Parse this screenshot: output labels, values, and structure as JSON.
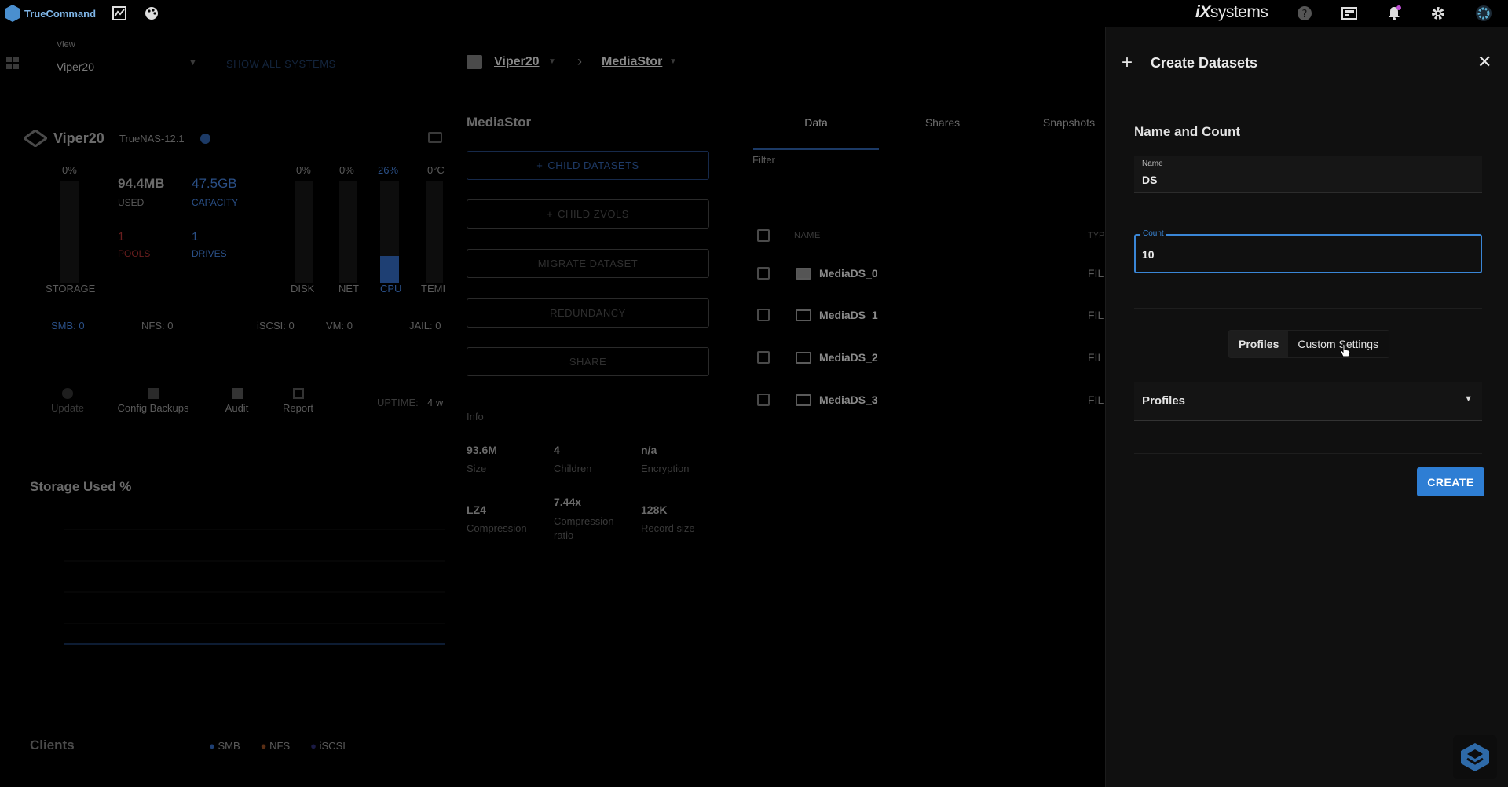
{
  "app": {
    "name": "TrueCommand"
  },
  "topbar": {
    "brand_prefix": "iX",
    "brand_suffix": "systems"
  },
  "view": {
    "label": "View",
    "selected": "Viper20",
    "show_all": "SHOW ALL SYSTEMS"
  },
  "breadcrumb": {
    "system": "Viper20",
    "pool": "MediaStor"
  },
  "system": {
    "name": "Viper20",
    "version": "TrueNAS-12.1",
    "storage_pct": "0%",
    "used_value": "94.4MB",
    "used_label": "USED",
    "capacity_value": "47.5GB",
    "capacity_label": "CAPACITY",
    "pools_value": "1",
    "pools_label": "POOLS",
    "drives_value": "1",
    "drives_label": "DRIVES",
    "storage_label": "STORAGE",
    "disk_pct": "0%",
    "disk_label": "DISK",
    "net_pct": "0%",
    "net_label": "NET",
    "cpu_pct": "26%",
    "cpu_label": "CPU",
    "cpu_level": 0.26,
    "temp_value": "0°C",
    "temp_label": "TEMI",
    "smb": "SMB: 0",
    "nfs": "NFS: 0",
    "iscsi": "iSCSI: 0",
    "vm": "VM: 0",
    "jail": "JAIL: 0",
    "actions": [
      "Update",
      "Config Backups",
      "Audit",
      "Report"
    ],
    "uptime_label": "UPTIME:",
    "uptime_value": "4 w"
  },
  "storage_chart": {
    "title": "Storage Used %"
  },
  "clients": {
    "title": "Clients",
    "legend": [
      "SMB",
      "NFS",
      "iSCSI"
    ]
  },
  "dataset": {
    "title": "MediaStor",
    "buttons": [
      "CHILD DATASETS",
      "CHILD ZVOLS",
      "MIGRATE DATASET",
      "REDUNDANCY",
      "SHARE"
    ],
    "info_label": "Info",
    "info": [
      {
        "value": "93.6M",
        "label": "Size"
      },
      {
        "value": "4",
        "label": "Children"
      },
      {
        "value": "n/a",
        "label": "Encryption"
      },
      {
        "value": "LZ4",
        "label": "Compression"
      },
      {
        "value": "7.44x",
        "label": "Compression ratio"
      },
      {
        "value": "128K",
        "label": "Record size"
      }
    ]
  },
  "table": {
    "tabs": [
      "Data",
      "Shares",
      "Snapshots"
    ],
    "filter_placeholder": "Filter",
    "col_name": "NAME",
    "col_type": "TYP",
    "rows": [
      {
        "name": "MediaDS_0",
        "type": "FIL"
      },
      {
        "name": "MediaDS_1",
        "type": "FIL"
      },
      {
        "name": "MediaDS_2",
        "type": "FIL"
      },
      {
        "name": "MediaDS_3",
        "type": "FIL"
      }
    ]
  },
  "panel": {
    "title": "Create Datasets",
    "section": "Name and Count",
    "name_label": "Name",
    "name_value": "DS",
    "count_label": "Count",
    "count_value": "10",
    "tab_profiles": "Profiles",
    "tab_custom": "Custom Settings",
    "profiles_select": "Profiles",
    "create_label": "CREATE"
  },
  "colors": {
    "accent": "#2e7ed4",
    "panel_bg": "#101010"
  }
}
